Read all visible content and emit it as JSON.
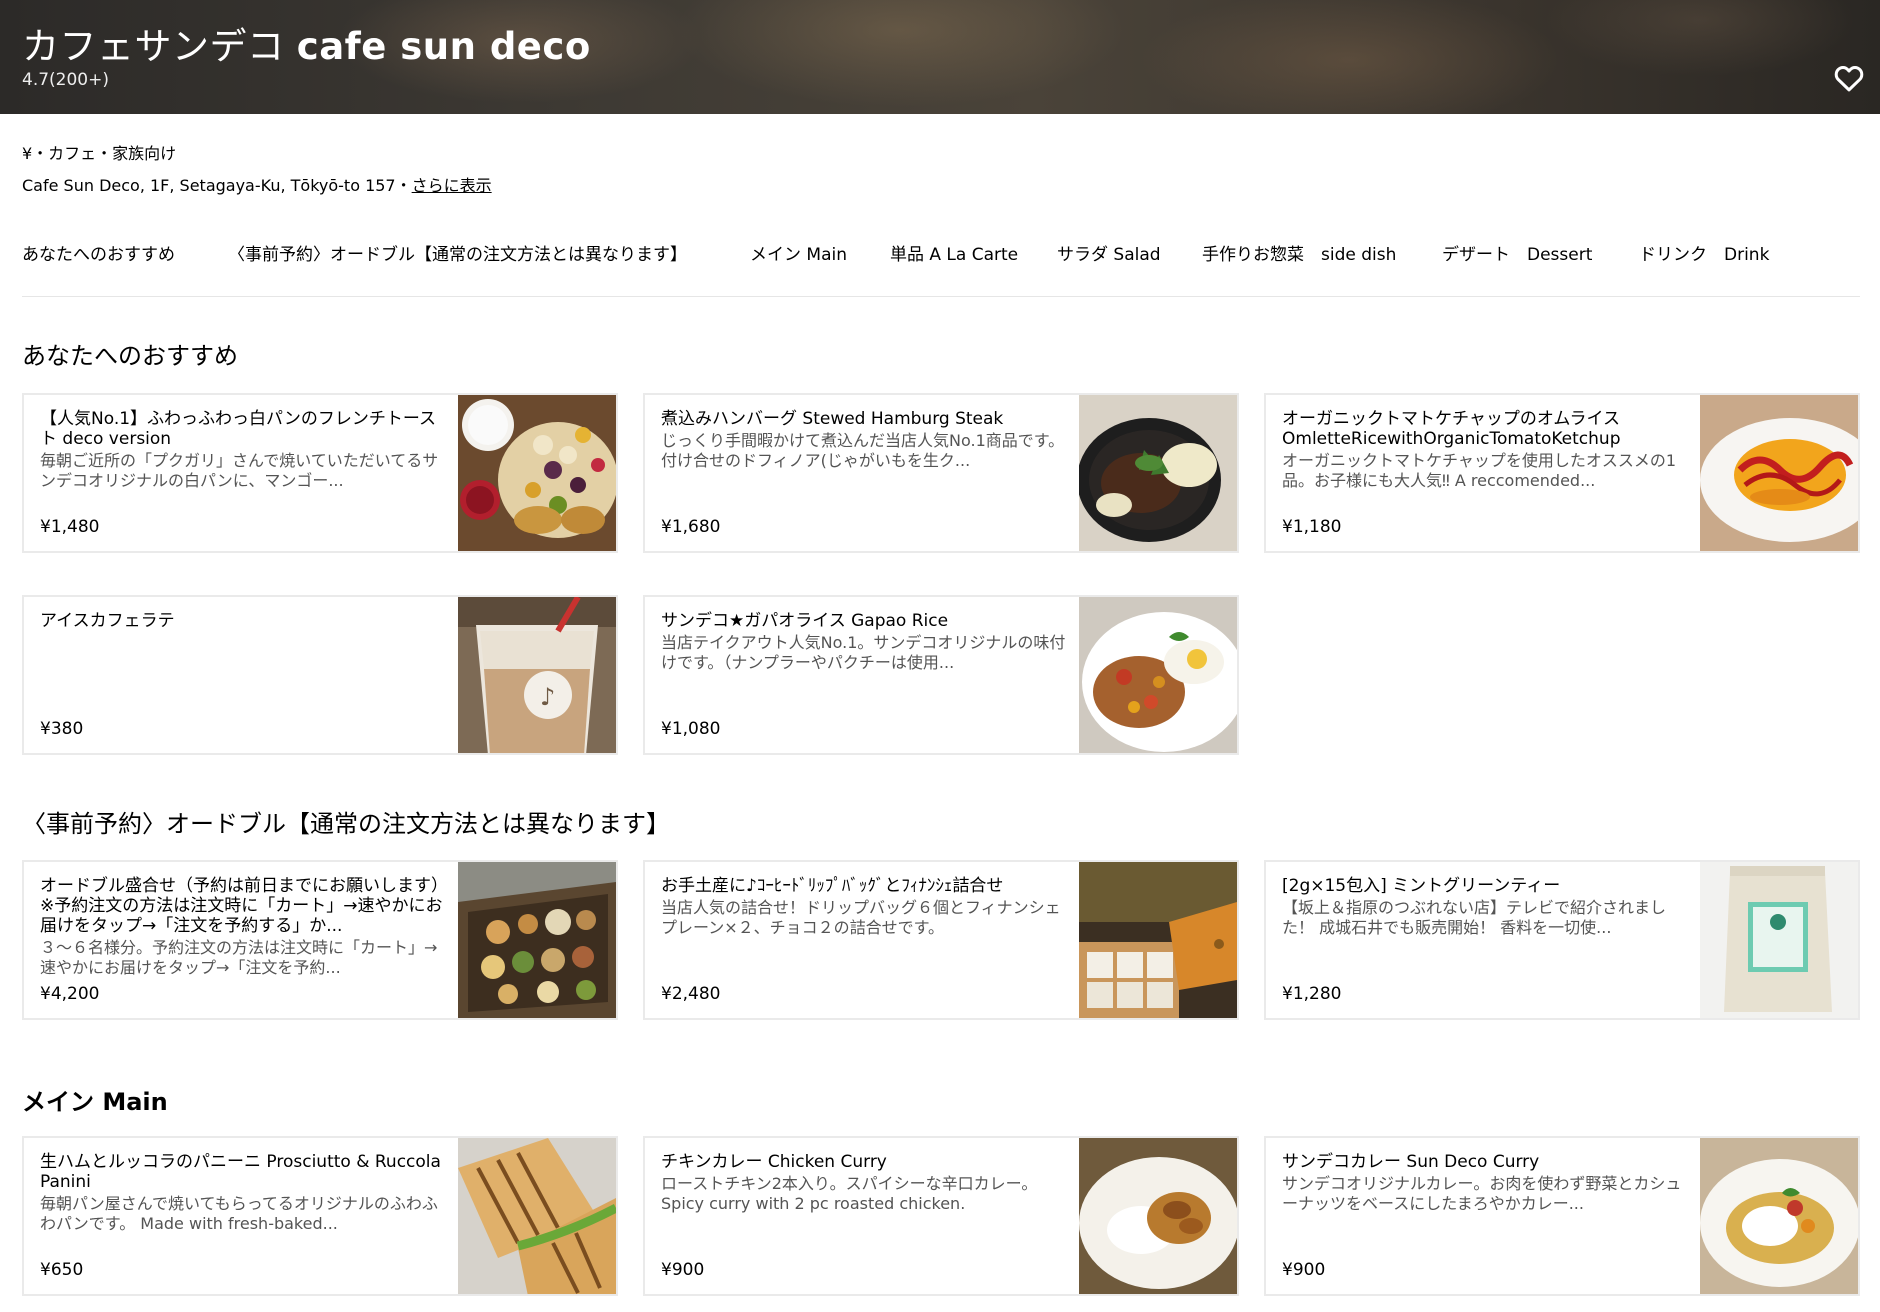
{
  "hero": {
    "title_ja": "カフェサンデコ",
    "title_en": "cafe sun deco",
    "rating": "4.7(200+)",
    "favorite_icon": "heart-icon"
  },
  "store": {
    "categories": "¥・カフェ・家族向け",
    "address": "Cafe Sun Deco, 1F, Setagaya-Ku, Tōkyō-to 157・",
    "more_link": "さらに表示"
  },
  "tabs": [
    {
      "label": "あなたへのおすすめ"
    },
    {
      "label": "〈事前予約〉オードブル【通常の注文方法とは異なります】"
    },
    {
      "label": "メイン Main"
    },
    {
      "label": "単品 A La Carte"
    },
    {
      "label": "サラダ Salad"
    },
    {
      "label": "手作りお惣菜　side dish"
    },
    {
      "label": "デザート　Dessert"
    },
    {
      "label": "ドリンク　Drink"
    }
  ],
  "sections": [
    {
      "title": "あなたへのおすすめ",
      "items": [
        {
          "name": "【人気No.1】ふわっふわっ白パンのフレンチトースト deco version",
          "desc": "毎朝ご近所の「プクガリ」さんで焼いていただいてるサンデコオリジナルの白パンに、マンゴー...",
          "price": "¥1,480"
        },
        {
          "name": "煮込みハンバーグ Stewed Hamburg Steak",
          "desc": "じっくり手間暇かけて煮込んだ当店人気No.1商品です。 付け合せのドフィノア(じゃがいもを生ク...",
          "price": "¥1,680"
        },
        {
          "name": "オーガニックトマトケチャップのオムライス OmletteRicewithOrganicTomatoKetchup",
          "desc": "オーガニックトマトケチャップを使用したオススメの1品。お子様にも大人気‼ A reccomended...",
          "price": "¥1,180"
        },
        {
          "name": "アイスカフェラテ",
          "desc": "",
          "price": "¥380"
        },
        {
          "name": "サンデコ★ガパオライス Gapao Rice",
          "desc": "当店テイクアウト人気No.1。サンデコオリジナルの味付けです。（ナンプラーやパクチーは使用...",
          "price": "¥1,080"
        }
      ]
    },
    {
      "title": "〈事前予約〉オードブル【通常の注文方法とは異なります】",
      "items": [
        {
          "name": "オードブル盛合せ（予約は前日までにお願いします）※予約注文の方法は注文時に「カート」→速やかにお届けをタップ→「注文を予約する」か...",
          "desc": "３〜６名様分。予約注文の方法は注文時に「カート」→速やかにお届けをタップ→「注文を予約...",
          "price": "¥4,200"
        },
        {
          "name": "お手土産に♪ｺｰﾋｰﾄﾞﾘｯﾌﾟﾊﾞｯｸﾞとﾌｨﾅﾝｼｪ詰合せ",
          "desc": "当店人気の詰合せ！ドリップバッグ６個とフィナンシェプレーン×２、チョコ２の詰合せです。",
          "price": "¥2,480"
        },
        {
          "name": "[2g×15包入] ミントグリーンティー",
          "desc": "【坂上＆指原のつぶれない店】テレビで紹介されました！ 成城石井でも販売開始！ 香料を一切使...",
          "price": "¥1,280"
        }
      ]
    },
    {
      "title": "メイン Main",
      "items": [
        {
          "name": "生ハムとルッコラのパニーニ Prosciutto & Ruccola Panini",
          "desc": "毎朝パン屋さんで焼いてもらってるオリジナルのふわふわパンです。 Made with fresh-baked...",
          "price": "¥650"
        },
        {
          "name": "チキンカレー Chicken Curry",
          "desc": "ローストチキン2本入り。スパイシーな辛口カレー。 Spicy curry with 2 pc roasted chicken.",
          "price": "¥900"
        },
        {
          "name": "サンデコカレー Sun Deco Curry",
          "desc": "サンデコオリジナルカレー。お肉を使わず野菜とカシューナッツをベースにしたまろやかカレー...",
          "price": "¥900"
        }
      ]
    }
  ]
}
